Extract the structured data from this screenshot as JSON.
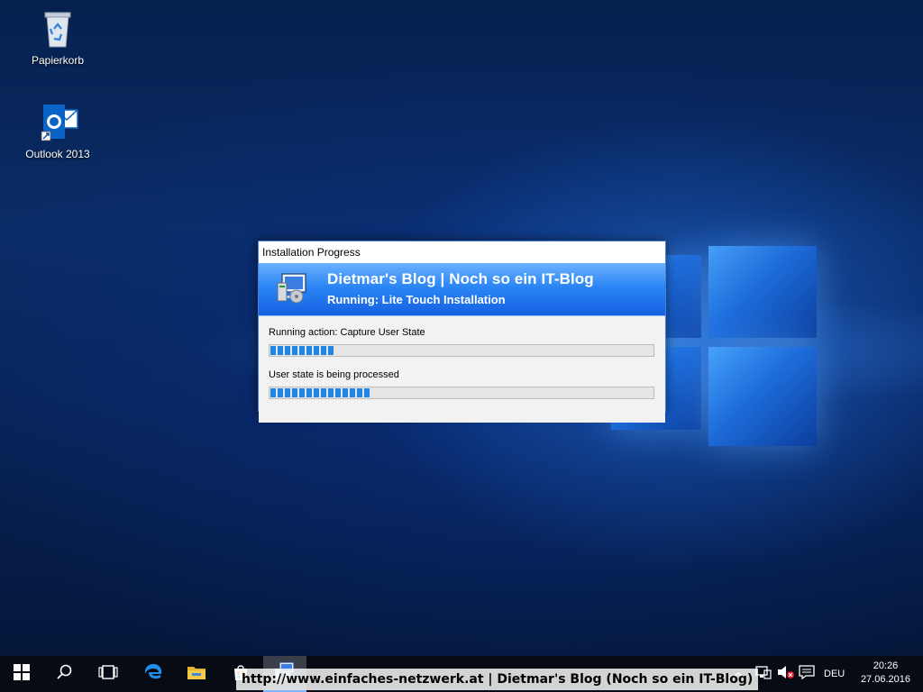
{
  "desktop": {
    "icons": [
      {
        "label": "Papierkorb",
        "icon": "recycle-bin-icon"
      },
      {
        "label": "Outlook 2013",
        "icon": "outlook-icon"
      }
    ]
  },
  "dialog": {
    "window_title": "Installation Progress",
    "header_title": "Dietmar's Blog | Noch so ein IT-Blog",
    "header_subtitle": "Running: Lite Touch Installation",
    "action_label": "Running action: Capture User State",
    "action_progress": 0.17,
    "state_label": "User state is being processed",
    "state_progress": 0.26,
    "header_color": "#2b86f4",
    "progress_color": "#1f86e8"
  },
  "taskbar": {
    "buttons": [
      "start-icon",
      "search-icon",
      "task-view-icon",
      "edge-icon",
      "file-explorer-icon",
      "store-icon",
      "installer-icon"
    ],
    "url_banner": "http://www.einfaches-netzwerk.at | Dietmar's Blog (Noch so ein IT-Blog)",
    "language": "DEU",
    "time": "20:26",
    "date": "27.06.2016"
  }
}
